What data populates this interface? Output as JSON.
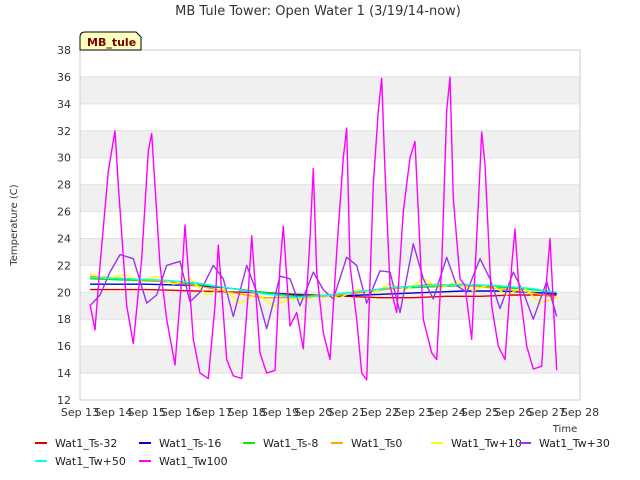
{
  "chart_data": {
    "type": "line",
    "title": "MB Tule Tower: Open Water 1 (3/19/14-now)",
    "xlabel": "Time",
    "ylabel": "Temperature (C)",
    "xlim": [
      13,
      28
    ],
    "ylim": [
      12,
      38
    ],
    "x_ticks": [
      "Sep 13",
      "Sep 14",
      "Sep 15",
      "Sep 16",
      "Sep 17",
      "Sep 18",
      "Sep 19",
      "Sep 20",
      "Sep 21",
      "Sep 22",
      "Sep 23",
      "Sep 24",
      "Sep 25",
      "Sep 26",
      "Sep 27",
      "Sep 28"
    ],
    "y_ticks": [
      12,
      14,
      16,
      18,
      20,
      22,
      24,
      26,
      28,
      30,
      32,
      34,
      36,
      38
    ],
    "grid": "horizontal bands",
    "legend_position": "bottom",
    "station_tag": "MB_tule",
    "series": [
      {
        "name": "Wat1_Ts-32",
        "color": "#dd0000",
        "x": [
          13.3,
          15,
          16.5,
          18,
          19,
          20,
          21,
          22,
          23,
          24,
          25,
          26,
          27,
          27.3
        ],
        "y": [
          20.2,
          20.2,
          20.1,
          20.0,
          19.9,
          19.8,
          19.7,
          19.6,
          19.6,
          19.7,
          19.7,
          19.8,
          19.8,
          19.8
        ]
      },
      {
        "name": "Wat1_Ts-16",
        "color": "#0000cc",
        "x": [
          13.3,
          15,
          16.5,
          17.5,
          18.5,
          19.5,
          20.5,
          21.5,
          22.5,
          23.5,
          24.5,
          25.5,
          26.5,
          27.3
        ],
        "y": [
          20.6,
          20.6,
          20.5,
          20.3,
          20.0,
          19.8,
          19.7,
          19.8,
          19.9,
          20.0,
          20.1,
          20.1,
          20.0,
          19.9
        ]
      },
      {
        "name": "Wat1_Ts-8",
        "color": "#00ee00",
        "x": [
          13.3,
          14.5,
          15.5,
          16.5,
          17.5,
          18.5,
          19.5,
          20.5,
          21.5,
          22.5,
          23.5,
          24.5,
          25.5,
          26.5,
          27.3
        ],
        "y": [
          21.0,
          20.9,
          20.8,
          20.6,
          20.3,
          20.0,
          19.7,
          19.8,
          20.1,
          20.3,
          20.4,
          20.5,
          20.4,
          20.2,
          20.0
        ]
      },
      {
        "name": "Wat1_Ts0",
        "color": "#ffa500",
        "x": [
          13.3,
          14.5,
          15.5,
          16.5,
          17.5,
          18.5,
          19.5,
          20.5,
          21.5,
          22.5,
          23.5,
          24.5,
          25.5,
          26.5,
          27.3
        ],
        "y": [
          21.2,
          21.0,
          20.8,
          20.5,
          20.0,
          19.6,
          19.6,
          19.7,
          20.0,
          20.3,
          20.6,
          20.5,
          20.3,
          20.0,
          19.6
        ]
      },
      {
        "name": "Wat1_Tw+10",
        "color": "#ffff00",
        "x": [
          13.3,
          13.8,
          14.3,
          14.8,
          15.3,
          15.8,
          16.3,
          16.8,
          17.3,
          17.8,
          18.3,
          18.8,
          19.3,
          19.8,
          20.3,
          20.8,
          21.3,
          21.8,
          22.3,
          22.8,
          23.3,
          23.8,
          24.3,
          24.8,
          25.3,
          25.8,
          26.3,
          26.8,
          27.3
        ],
        "y": [
          21.4,
          21.0,
          21.3,
          20.9,
          21.2,
          20.6,
          21.0,
          19.8,
          20.3,
          19.2,
          19.9,
          19.0,
          19.5,
          19.5,
          19.8,
          19.6,
          20.2,
          20.0,
          20.6,
          20.2,
          21.0,
          20.3,
          20.8,
          20.1,
          20.6,
          19.8,
          20.4,
          19.2,
          19.6
        ]
      },
      {
        "name": "Wat1_Tw+30",
        "color": "#9933ee",
        "x": [
          13.3,
          13.6,
          13.9,
          14.2,
          14.6,
          15.0,
          15.3,
          15.6,
          16.0,
          16.3,
          16.6,
          17.0,
          17.3,
          17.6,
          18.0,
          18.3,
          18.6,
          19.0,
          19.3,
          19.6,
          20.0,
          20.3,
          20.6,
          21.0,
          21.3,
          21.6,
          22.0,
          22.3,
          22.6,
          23.0,
          23.3,
          23.6,
          24.0,
          24.3,
          24.6,
          25.0,
          25.3,
          25.6,
          26.0,
          26.3,
          26.6,
          27.0,
          27.3
        ],
        "y": [
          19.0,
          19.8,
          21.5,
          22.8,
          22.5,
          19.2,
          19.8,
          22.0,
          22.3,
          19.3,
          20.0,
          22.0,
          21.0,
          18.2,
          22.0,
          20.0,
          17.3,
          21.2,
          21.0,
          19.0,
          21.5,
          20.2,
          19.5,
          22.6,
          22.0,
          19.2,
          21.6,
          21.5,
          18.5,
          23.6,
          21.0,
          19.5,
          22.6,
          20.5,
          20.0,
          22.5,
          21.0,
          18.8,
          21.5,
          20.0,
          18.0,
          20.8,
          18.2
        ]
      },
      {
        "name": "Wat1_Tw+50",
        "color": "#00ffff",
        "x": [
          13.3,
          14.5,
          15.5,
          16.5,
          17.5,
          18.5,
          19.5,
          20.5,
          21.5,
          22.5,
          23.5,
          24.5,
          25.5,
          26.5,
          27.3
        ],
        "y": [
          21.1,
          21.0,
          20.9,
          20.7,
          20.3,
          19.9,
          19.6,
          19.8,
          20.1,
          20.4,
          20.5,
          20.6,
          20.5,
          20.3,
          20.0
        ]
      },
      {
        "name": "Wat1_Tw100",
        "color": "#ff00ff",
        "x": [
          13.3,
          13.45,
          13.6,
          13.85,
          14.05,
          14.15,
          14.4,
          14.6,
          14.85,
          15.05,
          15.15,
          15.4,
          15.6,
          15.85,
          16.05,
          16.15,
          16.4,
          16.6,
          16.85,
          17.05,
          17.15,
          17.4,
          17.6,
          17.85,
          18.05,
          18.15,
          18.4,
          18.6,
          18.85,
          19.0,
          19.1,
          19.3,
          19.5,
          19.7,
          19.9,
          20.0,
          20.1,
          20.3,
          20.5,
          20.7,
          20.9,
          21.0,
          21.1,
          21.3,
          21.45,
          21.6,
          21.8,
          21.95,
          22.05,
          22.15,
          22.3,
          22.5,
          22.7,
          22.9,
          23.05,
          23.15,
          23.3,
          23.55,
          23.7,
          23.85,
          24.0,
          24.1,
          24.2,
          24.4,
          24.55,
          24.75,
          24.95,
          25.05,
          25.15,
          25.35,
          25.55,
          25.75,
          25.95,
          26.05,
          26.15,
          26.4,
          26.6,
          26.85,
          27.0,
          27.1,
          27.3
        ],
        "y": [
          19.1,
          17.2,
          22.0,
          29.0,
          32.0,
          28.0,
          19.0,
          16.2,
          22.5,
          30.5,
          31.8,
          22.0,
          18.0,
          14.6,
          21.0,
          25.0,
          16.5,
          14.0,
          13.6,
          19.0,
          23.5,
          15.0,
          13.8,
          13.6,
          20.0,
          24.2,
          15.5,
          14.0,
          14.2,
          22.0,
          24.9,
          17.5,
          18.5,
          15.8,
          24.0,
          29.2,
          21.5,
          17.0,
          15.0,
          23.0,
          30.0,
          32.2,
          22.0,
          18.0,
          14.0,
          13.5,
          28.0,
          33.5,
          35.9,
          29.0,
          20.5,
          18.5,
          26.0,
          30.0,
          31.2,
          26.0,
          18.0,
          15.5,
          15.0,
          22.0,
          33.5,
          36.0,
          27.0,
          21.0,
          20.5,
          16.5,
          26.5,
          31.9,
          29.5,
          19.0,
          16.0,
          15.0,
          22.0,
          24.7,
          21.0,
          16.0,
          14.3,
          14.5,
          21.0,
          24.0,
          14.2
        ]
      }
    ]
  }
}
